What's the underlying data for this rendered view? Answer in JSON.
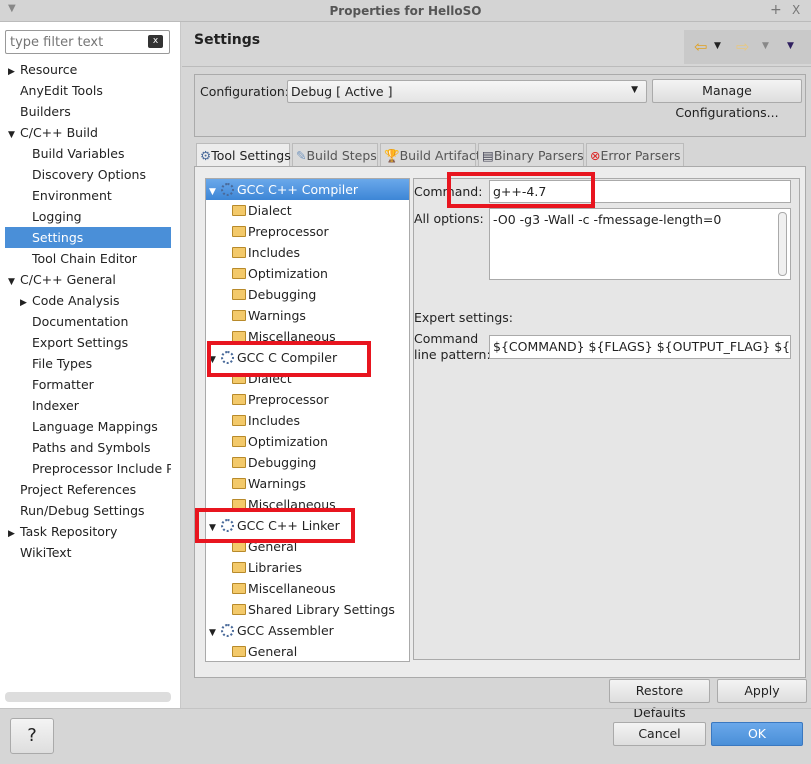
{
  "window": {
    "title": "Properties for HelloSO",
    "menu_icon": "triangle-down",
    "pin": "+",
    "close": "X"
  },
  "filter": {
    "placeholder": "type filter text",
    "clear_icon": "clear-icon"
  },
  "nav": [
    {
      "label": "Resource",
      "level": 0,
      "twisty": "collapsed"
    },
    {
      "label": "AnyEdit Tools",
      "level": 0
    },
    {
      "label": "Builders",
      "level": 0
    },
    {
      "label": "C/C++ Build",
      "level": 0,
      "twisty": "expanded"
    },
    {
      "label": "Build Variables",
      "level": 1
    },
    {
      "label": "Discovery Options",
      "level": 1
    },
    {
      "label": "Environment",
      "level": 1
    },
    {
      "label": "Logging",
      "level": 1
    },
    {
      "label": "Settings",
      "level": 1,
      "selected": true
    },
    {
      "label": "Tool Chain Editor",
      "level": 1
    },
    {
      "label": "C/C++ General",
      "level": 0,
      "twisty": "expanded"
    },
    {
      "label": "Code Analysis",
      "level": 1,
      "twisty": "collapsed"
    },
    {
      "label": "Documentation",
      "level": 1
    },
    {
      "label": "Export Settings",
      "level": 1
    },
    {
      "label": "File Types",
      "level": 1
    },
    {
      "label": "Formatter",
      "level": 1
    },
    {
      "label": "Indexer",
      "level": 1
    },
    {
      "label": "Language Mappings",
      "level": 1
    },
    {
      "label": "Paths and Symbols",
      "level": 1
    },
    {
      "label": "Preprocessor Include Pat",
      "level": 1
    },
    {
      "label": "Project References",
      "level": 0
    },
    {
      "label": "Run/Debug Settings",
      "level": 0
    },
    {
      "label": "Task Repository",
      "level": 0,
      "twisty": "collapsed"
    },
    {
      "label": "WikiText",
      "level": 0
    }
  ],
  "page": {
    "title": "Settings"
  },
  "config": {
    "label": "Configuration:",
    "value": "Debug  [ Active ]",
    "manage": "Manage Configurations..."
  },
  "tabs": [
    "Tool Settings",
    "Build Steps",
    "Build Artifact",
    "Binary Parsers",
    "Error Parsers"
  ],
  "tool_tree": [
    {
      "label": "GCC C++ Compiler",
      "tool": true,
      "selected": true
    },
    {
      "label": "Dialect"
    },
    {
      "label": "Preprocessor"
    },
    {
      "label": "Includes"
    },
    {
      "label": "Optimization"
    },
    {
      "label": "Debugging"
    },
    {
      "label": "Warnings"
    },
    {
      "label": "Miscellaneous"
    },
    {
      "label": "GCC C Compiler",
      "tool": true
    },
    {
      "label": "Dialect"
    },
    {
      "label": "Preprocessor"
    },
    {
      "label": "Includes"
    },
    {
      "label": "Optimization"
    },
    {
      "label": "Debugging"
    },
    {
      "label": "Warnings"
    },
    {
      "label": "Miscellaneous"
    },
    {
      "label": "GCC C++ Linker",
      "tool": true
    },
    {
      "label": "General"
    },
    {
      "label": "Libraries"
    },
    {
      "label": "Miscellaneous"
    },
    {
      "label": "Shared Library Settings"
    },
    {
      "label": "GCC Assembler",
      "tool": true
    },
    {
      "label": "General"
    }
  ],
  "tool": {
    "command_label": "Command:",
    "command": "g++-4.7",
    "all_options_label": "All options:",
    "all_options": "-O0 -g3 -Wall -c -fmessage-length=0",
    "expert_label": "Expert settings:",
    "pattern_label1": "Command",
    "pattern_label2": "line pattern:",
    "pattern": "${COMMAND} ${FLAGS} ${OUTPUT_FLAG} ${OUTPUT_PREFIX}${OUTPUT} ${INPUTS}"
  },
  "buttons": {
    "restore": "Restore Defaults",
    "apply": "Apply",
    "cancel": "Cancel",
    "ok": "OK",
    "help": "?"
  },
  "colors": {
    "accent": "#4a8fd8",
    "highlight": "#e8151f"
  }
}
